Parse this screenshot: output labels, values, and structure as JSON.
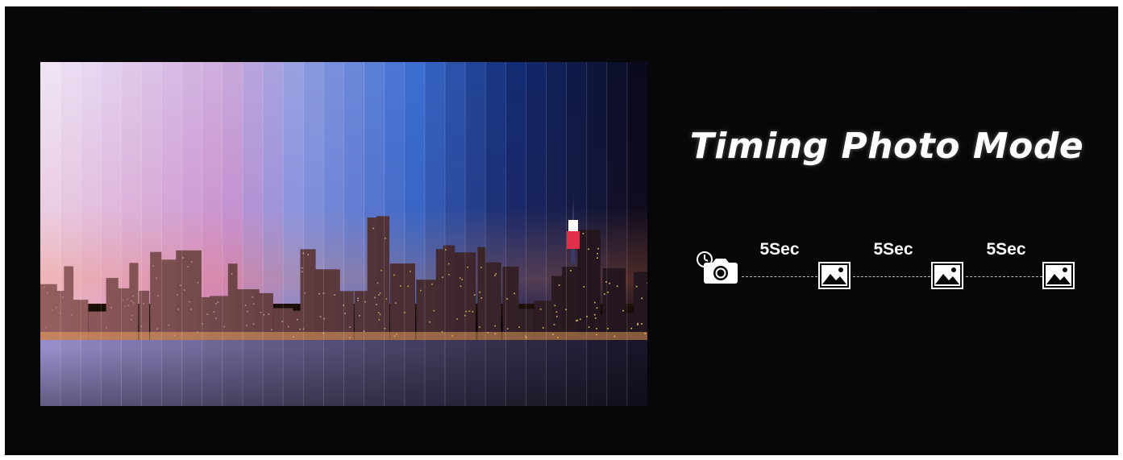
{
  "title": "Timing Photo Mode",
  "sequence": {
    "interval_labels": [
      "5Sec",
      "5Sec",
      "5Sec"
    ],
    "start_icon": "timer-camera-icon",
    "frame_icon": "image-icon"
  },
  "colors": {
    "background": "#070709",
    "text": "#ffffff",
    "dash": "#bdbdbd"
  }
}
